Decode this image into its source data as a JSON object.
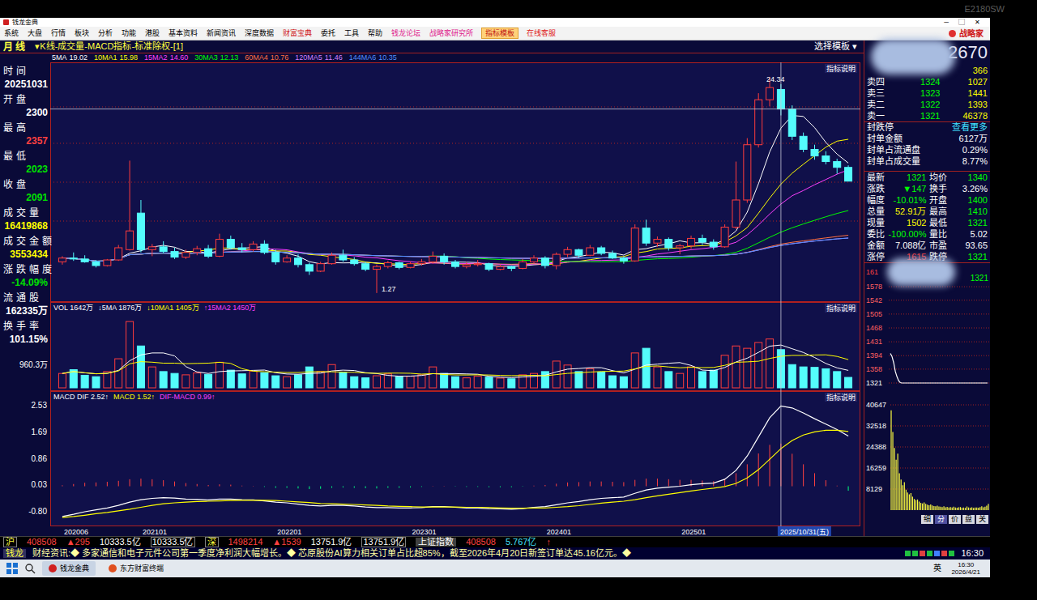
{
  "monitor": {
    "model": "E2180SW"
  },
  "window": {
    "title": "钱龙金典",
    "controls": [
      "─",
      "▢",
      "✕"
    ]
  },
  "menu": [
    {
      "label": "系统",
      "color": "#000000",
      "selected": false
    },
    {
      "label": "大盘",
      "color": "#000000",
      "selected": false
    },
    {
      "label": "行情",
      "color": "#000000",
      "selected": false
    },
    {
      "label": "板块",
      "color": "#000000",
      "selected": false
    },
    {
      "label": "分析",
      "color": "#000000",
      "selected": false
    },
    {
      "label": "功能",
      "color": "#000000",
      "selected": false
    },
    {
      "label": "港股",
      "color": "#000000",
      "selected": false
    },
    {
      "label": "基本资料",
      "color": "#000000",
      "selected": false
    },
    {
      "label": "新闻资讯",
      "color": "#000000",
      "selected": false
    },
    {
      "label": "深度数据",
      "color": "#000000",
      "selected": false
    },
    {
      "label": "财富宝典",
      "color": "#d01818",
      "selected": false
    },
    {
      "label": "委托",
      "color": "#000000",
      "selected": false
    },
    {
      "label": "工具",
      "color": "#000000",
      "selected": false
    },
    {
      "label": "帮助",
      "color": "#000000",
      "selected": false
    },
    {
      "label": "钱龙论坛",
      "color": "#e0208c",
      "selected": false
    },
    {
      "label": "战略家研究所",
      "color": "#e0208c",
      "selected": false
    },
    {
      "label": "指标模板",
      "color": "#c01010",
      "selected": true
    },
    {
      "label": "在线客服",
      "color": "#e02020",
      "selected": false
    }
  ],
  "brand": "战略家",
  "chart_header": {
    "period": "月 线",
    "title": "▾K线-成交量-MACD指标-标准除权-[1]",
    "template": "选择模板 ▾",
    "code": "2670"
  },
  "ma_legend": [
    {
      "label": "5MA",
      "value": "19.02",
      "color": "#ffffff",
      "period": 5
    },
    {
      "label": "10MA1",
      "value": "15.98",
      "color": "#ffff00",
      "period": 10
    },
    {
      "label": "15MA2",
      "value": "14.60",
      "color": "#ff40ff",
      "period": 15
    },
    {
      "label": "30MA3",
      "value": "12.13",
      "color": "#00ff00",
      "period": 30
    },
    {
      "label": "60MA4",
      "value": "10.76",
      "color": "#ff7040",
      "period": 60
    },
    {
      "label": "120MA5",
      "value": "11.46",
      "color": "#d080ff",
      "period": 120
    },
    {
      "label": "144MA6",
      "value": "10.35",
      "color": "#5090ff",
      "period": 144
    }
  ],
  "info": [
    {
      "label": "时间",
      "value": "20251031",
      "color": "#ffffff"
    },
    {
      "label": "开盘",
      "value": "2300",
      "color": "#ffffff"
    },
    {
      "label": "最高",
      "value": "2357",
      "color": "#ff4040"
    },
    {
      "label": "最低",
      "value": "2023",
      "color": "#00e000"
    },
    {
      "label": "收盘",
      "value": "2091",
      "color": "#00e000"
    },
    {
      "label": "成交量",
      "value": "16419868",
      "color": "#ffff00"
    },
    {
      "label": "成交金额",
      "value": "3553434",
      "color": "#ffff00"
    },
    {
      "label": "涨跌幅度",
      "value": "-14.09%",
      "color": "#00e000"
    },
    {
      "label": "流通股",
      "value": "162335万",
      "color": "#ffffff"
    },
    {
      "label": "换手率",
      "value": "101.15%",
      "color": "#ffffff"
    }
  ],
  "price_chart": {
    "explain": "指标说明",
    "high_label": "24.34",
    "low_label": "1.27",
    "cursor_index": 64,
    "cursor_label": "2025/10/31(五)",
    "x_ticks": [
      {
        "label": "202006",
        "index": 0
      },
      {
        "label": "202101",
        "index": 7
      },
      {
        "label": "202201",
        "index": 19
      },
      {
        "label": "202301",
        "index": 31
      },
      {
        "label": "202401",
        "index": 43
      },
      {
        "label": "202501",
        "index": 55
      }
    ],
    "candles": [
      [
        4.6,
        5.2,
        4.3,
        5.0
      ],
      [
        5.0,
        5.6,
        4.7,
        4.9
      ],
      [
        4.9,
        5.3,
        4.5,
        4.6
      ],
      [
        4.6,
        4.8,
        4.0,
        4.2
      ],
      [
        4.2,
        4.9,
        4.1,
        4.8
      ],
      [
        4.8,
        6.4,
        4.7,
        6.1
      ],
      [
        5.9,
        15.4,
        5.8,
        7.9
      ],
      [
        9.8,
        11.2,
        5.6,
        5.9
      ],
      [
        5.9,
        6.5,
        5.2,
        6.2
      ],
      [
        6.2,
        6.8,
        5.5,
        5.7
      ],
      [
        5.7,
        6.1,
        4.9,
        5.1
      ],
      [
        5.1,
        5.9,
        4.9,
        5.6
      ],
      [
        5.6,
        6.3,
        5.3,
        6.0
      ],
      [
        6.0,
        6.4,
        5.0,
        5.2
      ],
      [
        5.2,
        7.6,
        5.1,
        7.0
      ],
      [
        7.0,
        7.4,
        5.9,
        6.1
      ],
      [
        6.1,
        6.6,
        5.6,
        5.9
      ],
      [
        5.9,
        6.8,
        5.7,
        6.5
      ],
      [
        6.5,
        6.9,
        5.4,
        5.6
      ],
      [
        5.6,
        5.9,
        4.3,
        4.6
      ],
      [
        4.6,
        5.3,
        4.5,
        5.0
      ],
      [
        5.0,
        5.4,
        4.0,
        4.3
      ],
      [
        4.3,
        4.5,
        3.2,
        3.6
      ],
      [
        3.6,
        4.6,
        3.5,
        4.4
      ],
      [
        4.4,
        5.6,
        4.3,
        5.3
      ],
      [
        5.3,
        5.9,
        4.6,
        4.8
      ],
      [
        4.8,
        5.1,
        4.2,
        4.4
      ],
      [
        4.4,
        4.6,
        3.6,
        3.8
      ],
      [
        3.8,
        4.3,
        1.27,
        4.1
      ],
      [
        4.1,
        4.7,
        3.9,
        4.5
      ],
      [
        4.5,
        4.6,
        3.8,
        4.0
      ],
      [
        4.0,
        4.6,
        3.9,
        4.4
      ],
      [
        4.4,
        4.9,
        4.2,
        4.6
      ],
      [
        4.6,
        5.7,
        4.4,
        5.2
      ],
      [
        5.2,
        5.5,
        4.3,
        4.6
      ],
      [
        4.6,
        4.8,
        3.9,
        4.1
      ],
      [
        4.1,
        4.6,
        3.9,
        4.3
      ],
      [
        4.3,
        4.8,
        4.1,
        4.4
      ],
      [
        4.4,
        4.5,
        3.6,
        3.8
      ],
      [
        3.8,
        4.3,
        3.7,
        4.1
      ],
      [
        4.1,
        4.2,
        3.6,
        3.9
      ],
      [
        3.9,
        4.9,
        3.8,
        4.6
      ],
      [
        4.6,
        5.3,
        4.4,
        5.0
      ],
      [
        5.0,
        5.2,
        3.9,
        4.2
      ],
      [
        4.2,
        5.6,
        3.8,
        5.4
      ],
      [
        5.4,
        6.2,
        5.1,
        5.9
      ],
      [
        5.9,
        6.0,
        5.0,
        5.3
      ],
      [
        5.3,
        6.4,
        5.2,
        6.1
      ],
      [
        6.1,
        6.3,
        5.3,
        5.5
      ],
      [
        5.5,
        5.8,
        4.9,
        5.0
      ],
      [
        5.0,
        5.2,
        4.4,
        4.7
      ],
      [
        4.7,
        8.6,
        4.6,
        8.2
      ],
      [
        8.2,
        9.1,
        6.3,
        6.6
      ],
      [
        6.6,
        7.3,
        6.2,
        7.0
      ],
      [
        7.0,
        7.2,
        5.8,
        6.1
      ],
      [
        6.1,
        6.5,
        5.4,
        6.3
      ],
      [
        6.3,
        7.4,
        6.0,
        7.1
      ],
      [
        7.1,
        7.5,
        6.4,
        6.7
      ],
      [
        6.7,
        7.0,
        5.9,
        6.2
      ],
      [
        6.2,
        8.6,
        6.1,
        8.3
      ],
      [
        8.3,
        15.3,
        8.1,
        11.2
      ],
      [
        11.2,
        17.8,
        10.9,
        17.1
      ],
      [
        17.1,
        22.6,
        16.8,
        21.9
      ],
      [
        21.9,
        24.34,
        21.2,
        23.2
      ],
      [
        23.0,
        23.57,
        20.23,
        20.91
      ],
      [
        20.91,
        21.3,
        17.6,
        18.0
      ],
      [
        18.0,
        18.4,
        16.3,
        16.6
      ],
      [
        16.6,
        17.1,
        15.5,
        15.9
      ],
      [
        15.9,
        16.4,
        15.0,
        15.3
      ],
      [
        15.3,
        15.6,
        14.0,
        14.68
      ],
      [
        14.68,
        14.9,
        13.21,
        13.21
      ]
    ]
  },
  "volume_chart": {
    "explain": "指标说明",
    "tick": "960.3万",
    "max": 3200,
    "legend": [
      {
        "text": "VOL 1642万",
        "color": "#ffffff"
      },
      {
        "text": "↓5MA 1876万",
        "color": "#ffffff"
      },
      {
        "text": "↓10MA1 1405万",
        "color": "#ffff00"
      },
      {
        "text": "↑15MA2 1450万",
        "color": "#ff40ff"
      }
    ],
    "values": [
      620,
      780,
      540,
      480,
      700,
      1250,
      2850,
      1800,
      900,
      700,
      620,
      560,
      640,
      580,
      1100,
      760,
      600,
      720,
      650,
      520,
      480,
      560,
      900,
      700,
      1000,
      650,
      480,
      430,
      520,
      600,
      480,
      500,
      560,
      900,
      620,
      480,
      430,
      500,
      460,
      420,
      390,
      560,
      620,
      700,
      1150,
      980,
      700,
      820,
      680,
      520,
      480,
      1500,
      1700,
      900,
      700,
      620,
      900,
      700,
      760,
      1400,
      1800,
      1700,
      1950,
      2100,
      1642,
      1000,
      900,
      880,
      820,
      700,
      450
    ]
  },
  "macd_chart": {
    "explain": "指标说明",
    "ticks": [
      "2.53",
      "1.69",
      "0.86",
      "0.03",
      "-0.80"
    ],
    "legend": [
      {
        "text": "MACD DIF 2.52↑",
        "color": "#ffffff"
      },
      {
        "text": "MACD 1.52↑",
        "color": "#ffff00"
      },
      {
        "text": "DIF-MACD 0.99↑",
        "color": "#ff40ff"
      }
    ],
    "dif": [
      -0.95,
      -0.88,
      -0.8,
      -0.74,
      -0.68,
      -0.6,
      -0.5,
      -0.42,
      -0.38,
      -0.36,
      -0.37,
      -0.4,
      -0.41,
      -0.43,
      -0.4,
      -0.4,
      -0.42,
      -0.43,
      -0.46,
      -0.5,
      -0.52,
      -0.56,
      -0.6,
      -0.62,
      -0.6,
      -0.6,
      -0.62,
      -0.65,
      -0.67,
      -0.67,
      -0.68,
      -0.68,
      -0.67,
      -0.64,
      -0.64,
      -0.66,
      -0.68,
      -0.68,
      -0.7,
      -0.71,
      -0.72,
      -0.7,
      -0.66,
      -0.64,
      -0.58,
      -0.52,
      -0.48,
      -0.42,
      -0.38,
      -0.36,
      -0.34,
      -0.22,
      -0.12,
      -0.06,
      -0.03,
      0.0,
      0.05,
      0.08,
      0.1,
      0.22,
      0.5,
      0.95,
      1.55,
      2.15,
      2.52,
      2.46,
      2.3,
      2.12,
      1.95,
      1.78,
      1.58
    ],
    "dea": [
      -0.98,
      -0.95,
      -0.91,
      -0.86,
      -0.82,
      -0.77,
      -0.72,
      -0.66,
      -0.6,
      -0.55,
      -0.52,
      -0.5,
      -0.48,
      -0.47,
      -0.46,
      -0.45,
      -0.44,
      -0.44,
      -0.44,
      -0.45,
      -0.47,
      -0.49,
      -0.51,
      -0.54,
      -0.55,
      -0.56,
      -0.57,
      -0.59,
      -0.6,
      -0.62,
      -0.63,
      -0.64,
      -0.65,
      -0.65,
      -0.65,
      -0.65,
      -0.66,
      -0.66,
      -0.67,
      -0.68,
      -0.69,
      -0.69,
      -0.68,
      -0.68,
      -0.66,
      -0.64,
      -0.61,
      -0.57,
      -0.53,
      -0.5,
      -0.47,
      -0.42,
      -0.36,
      -0.3,
      -0.25,
      -0.2,
      -0.15,
      -0.1,
      -0.06,
      -0.01,
      0.09,
      0.26,
      0.52,
      0.85,
      1.18,
      1.44,
      1.61,
      1.71,
      1.76,
      1.76,
      1.72
    ]
  },
  "order_book": [
    {
      "label": "",
      "price": "",
      "volume": "366"
    },
    {
      "label": "卖四",
      "price": "1324",
      "volume": "1027"
    },
    {
      "label": "卖三",
      "price": "1323",
      "volume": "1441"
    },
    {
      "label": "卖二",
      "price": "1322",
      "volume": "1393"
    },
    {
      "label": "卖一",
      "price": "1321",
      "volume": "46378"
    }
  ],
  "seal": {
    "title": "封跌停",
    "more": "查看更多",
    "rows": [
      {
        "label": "封单金额",
        "value": "6127万"
      },
      {
        "label": "封单占流通盘",
        "value": "0.29%"
      },
      {
        "label": "封单占成交量",
        "value": "8.77%"
      }
    ]
  },
  "quote": [
    [
      {
        "label": "最新",
        "value": "1321",
        "color": "#00ff00"
      },
      {
        "label": "均价",
        "value": "1340",
        "color": "#00ff00"
      }
    ],
    [
      {
        "label": "涨跌",
        "value": "▼147",
        "color": "#00ff00"
      },
      {
        "label": "换手",
        "value": "3.26%",
        "color": "#ffffff"
      }
    ],
    [
      {
        "label": "幅度",
        "value": "-10.01%",
        "color": "#00ff00"
      },
      {
        "label": "开盘",
        "value": "1400",
        "color": "#00ff00"
      }
    ],
    [
      {
        "label": "总量",
        "value": "52.91万",
        "color": "#ffff00"
      },
      {
        "label": "最高",
        "value": "1410",
        "color": "#00ff00"
      }
    ],
    [
      {
        "label": "现量",
        "value": "1502",
        "color": "#ffff00"
      },
      {
        "label": "最低",
        "value": "1321",
        "color": "#00ff00"
      }
    ],
    [
      {
        "label": "委比",
        "value": "-100.00%",
        "color": "#00ff00"
      },
      {
        "label": "量比",
        "value": "5.02",
        "color": "#ffffff"
      }
    ],
    [
      {
        "label": "金额",
        "value": "7.088亿",
        "color": "#ffffff"
      },
      {
        "label": "市盈",
        "value": "93.65",
        "color": "#ffffff"
      }
    ],
    [
      {
        "label": "涨停",
        "value": "1615",
        "color": "#ff3030"
      },
      {
        "label": "跌停",
        "value": "1321",
        "color": "#00ff00"
      }
    ]
  ],
  "intraday": {
    "top_label": "161",
    "marker": "1321",
    "ticks": [
      "1578",
      "1542",
      "1505",
      "1468",
      "1431",
      "1394",
      "1358",
      "1321"
    ],
    "prices": [
      1400,
      1392,
      1375,
      1352,
      1338,
      1327,
      1322,
      1321,
      1321,
      1321,
      1321,
      1321,
      1321,
      1321,
      1321,
      1321,
      1321,
      1321,
      1321,
      1321,
      1321,
      1321,
      1321,
      1321,
      1321,
      1321,
      1321,
      1321,
      1321,
      1321,
      1321,
      1321,
      1321,
      1321,
      1321,
      1321,
      1321,
      1321,
      1321,
      1321,
      1321,
      1321,
      1321,
      1321,
      1321,
      1321,
      1321,
      1321,
      1321,
      1321,
      1321,
      1321,
      1321,
      1321,
      1321,
      1321,
      1321,
      1321,
      1321,
      1321
    ],
    "vol_ticks": [
      "40647",
      "32518",
      "24388",
      "16259",
      "8129"
    ],
    "volumes": [
      38500,
      30200,
      24000,
      19500,
      21800,
      14200,
      11800,
      9600,
      10800,
      7900,
      6800,
      6100,
      6600,
      5200,
      4300,
      3900,
      4100,
      3300,
      2800,
      2600,
      3000,
      2400,
      2100,
      1900,
      2200,
      1800,
      1600,
      1500,
      1700,
      1400,
      1300,
      1200,
      1450,
      1100,
      1250,
      1000,
      1150,
      980,
      1320,
      1050,
      900,
      1100,
      1200,
      950,
      1000,
      880,
      1400,
      1020,
      960,
      1100,
      870,
      990,
      1050,
      930,
      1200,
      1500,
      1100,
      1300,
      1700,
      2400
    ],
    "tabs": [
      {
        "label": "细",
        "selected": false
      },
      {
        "label": "分",
        "selected": true
      },
      {
        "label": "价",
        "selected": false
      },
      {
        "label": "盘",
        "selected": false
      },
      {
        "label": "关",
        "selected": false
      }
    ]
  },
  "status_bar": {
    "sh_label": "沪",
    "sh_index": "408508",
    "sh_change": "▲295",
    "sh_amount": "10333.5亿",
    "sh_amount_box": "10333.5亿",
    "sz_label": "深",
    "sz_index": "1498214",
    "sz_change": "▲1539",
    "sz_amount": "13751.9亿",
    "sz_amount_box": "13751.9亿",
    "index_name": "上证指数",
    "index_value": "408508",
    "index_amount": "5.767亿",
    "arrow": "↑"
  },
  "ticker": {
    "brand": "钱龙",
    "text": "财经资讯:◆ 多家通信和电子元件公司第一季度净利润大幅增长。◆ 芯原股份AI算力相关订单占比超85%，截至2026年4月20日新签订单达45.16亿元。◆",
    "time": "16:30"
  },
  "taskbar": {
    "apps": [
      {
        "label": "钱龙金典",
        "selected": true
      },
      {
        "label": "东方财富终端",
        "selected": false
      }
    ],
    "ime": "英",
    "time": "16:30",
    "date": "2026/4/21"
  }
}
